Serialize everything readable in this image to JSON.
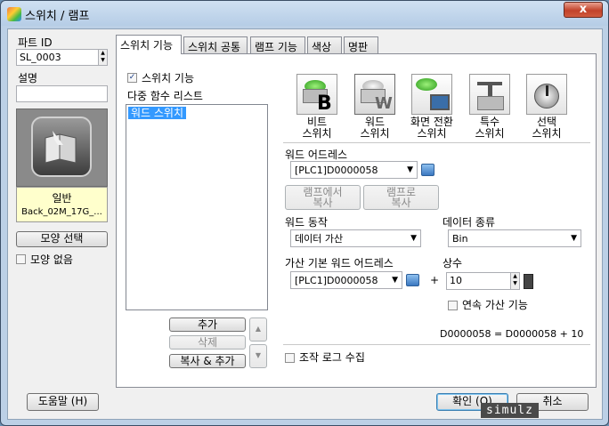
{
  "window": {
    "title": "스위치 / 램프",
    "close_glyph": "x"
  },
  "left_panel": {
    "part_id_label": "파트 ID",
    "part_id_value": "SL_0003",
    "description_label": "설명",
    "description_value": "",
    "shape_category": "일반",
    "shape_name": "Back_02M_17G_...",
    "select_shape_button": "모양 선택",
    "no_shape_label": "모양 없음",
    "no_shape_checked": false
  },
  "tabs": [
    {
      "label": "스위치 기능",
      "active": true
    },
    {
      "label": "스위치 공통",
      "active": false
    },
    {
      "label": "램프 기능",
      "active": false
    },
    {
      "label": "색상",
      "active": false
    },
    {
      "label": "명판",
      "active": false
    }
  ],
  "switch_function": {
    "enable_label": "스위치 기능",
    "enable_checked": true,
    "multi_list_label": "다중 함수 리스트",
    "list_items": [
      {
        "label": "워드 스위치",
        "selected": true
      }
    ],
    "add_button": "추가",
    "delete_button": "삭제",
    "copy_add_button": "복사 & 추가",
    "types": [
      {
        "label_line1": "비트",
        "label_line2": "스위치",
        "icon": "bit-switch-icon",
        "letter": "B"
      },
      {
        "label_line1": "워드",
        "label_line2": "스위치",
        "icon": "word-switch-icon",
        "letter": "W",
        "selected": true
      },
      {
        "label_line1": "화면 전환",
        "label_line2": "스위치",
        "icon": "screen-change-switch-icon"
      },
      {
        "label_line1": "특수",
        "label_line2": "스위치",
        "icon": "special-switch-icon"
      },
      {
        "label_line1": "선택",
        "label_line2": "스위치",
        "icon": "selector-switch-icon"
      }
    ],
    "word_address_label": "워드 어드레스",
    "word_address_value": "[PLC1]D0000058",
    "copy_from_lamp_button": "램프에서\n복사",
    "copy_to_lamp_button": "램프로\n복사",
    "word_action_label": "워드 동작",
    "word_action_value": "데이터 가산",
    "data_type_label": "데이터 종류",
    "data_type_value": "Bin",
    "base_address_label": "가산 기본 워드 어드레스",
    "base_address_value": "[PLC1]D0000058",
    "plus_sign": "+",
    "constant_label": "상수",
    "constant_value": "10",
    "continuous_add_label": "연속 가산 기능",
    "continuous_add_checked": false,
    "formula": "D0000058 = D0000058 + 10",
    "operation_log_label": "조작 로그 수집",
    "operation_log_checked": false
  },
  "footer": {
    "help_button": "도움말 (H)",
    "ok_button": "확인 (O)",
    "cancel_button": "취소"
  },
  "watermark": "simulz"
}
